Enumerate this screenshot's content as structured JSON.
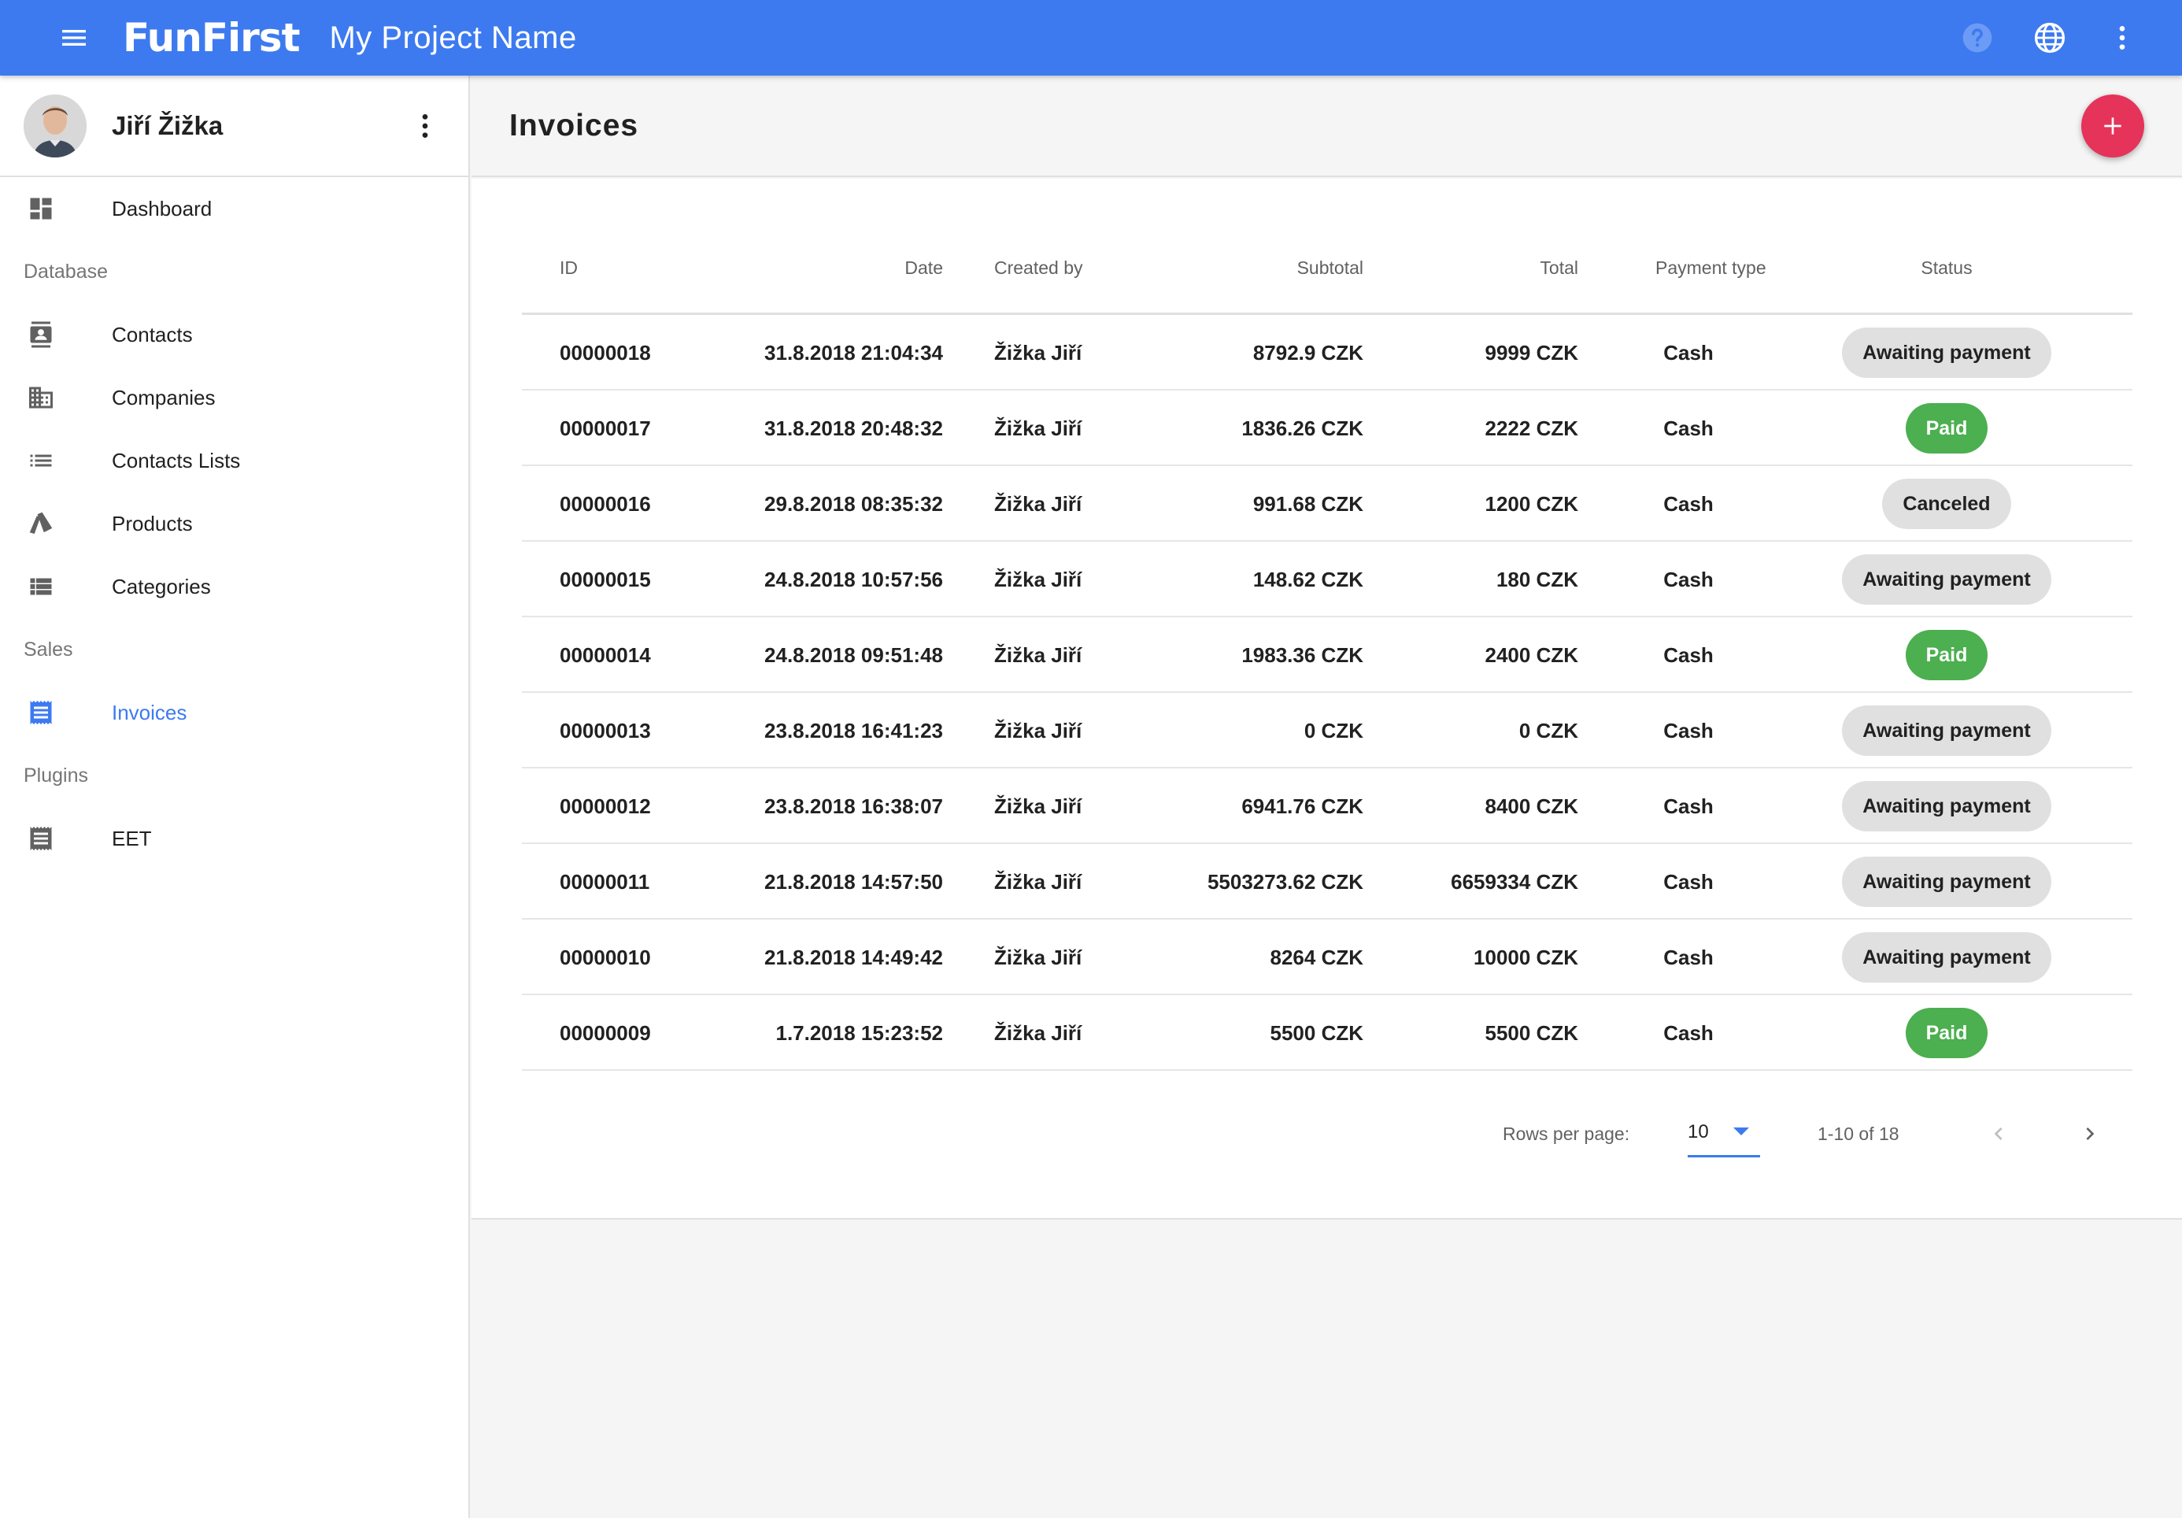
{
  "appbar": {
    "brand": "FunFirst",
    "project": "My Project Name",
    "icons": [
      "menu-icon",
      "help-icon",
      "globe-icon",
      "more-vert-icon"
    ],
    "color": "#3d7af0"
  },
  "sidebar": {
    "user_name": "Jiří Žižka",
    "dashboard": "Dashboard",
    "sections": {
      "database": "Database",
      "sales": "Sales",
      "plugins": "Plugins"
    },
    "items": {
      "contacts": "Contacts",
      "companies": "Companies",
      "contacts_lists": "Contacts Lists",
      "products": "Products",
      "categories": "Categories",
      "invoices": "Invoices",
      "eet": "EET"
    },
    "active": "invoices",
    "active_color": "#3d7af0"
  },
  "page": {
    "title": "Invoices",
    "fab_color": "#e5335a"
  },
  "table": {
    "headers": {
      "id": "ID",
      "date": "Date",
      "created_by": "Created by",
      "subtotal": "Subtotal",
      "total": "Total",
      "payment_type": "Payment type",
      "status": "Status"
    },
    "rows": [
      {
        "id": "00000018",
        "date": "31.8.2018 21:04:34",
        "created_by": "Žižka Jiří",
        "subtotal": "8792.9 CZK",
        "total": "9999 CZK",
        "payment_type": "Cash",
        "status": "Awaiting payment",
        "status_kind": "awaiting"
      },
      {
        "id": "00000017",
        "date": "31.8.2018 20:48:32",
        "created_by": "Žižka Jiří",
        "subtotal": "1836.26 CZK",
        "total": "2222 CZK",
        "payment_type": "Cash",
        "status": "Paid",
        "status_kind": "paid"
      },
      {
        "id": "00000016",
        "date": "29.8.2018 08:35:32",
        "created_by": "Žižka Jiří",
        "subtotal": "991.68 CZK",
        "total": "1200 CZK",
        "payment_type": "Cash",
        "status": "Canceled",
        "status_kind": "canceled"
      },
      {
        "id": "00000015",
        "date": "24.8.2018 10:57:56",
        "created_by": "Žižka Jiří",
        "subtotal": "148.62 CZK",
        "total": "180 CZK",
        "payment_type": "Cash",
        "status": "Awaiting payment",
        "status_kind": "awaiting"
      },
      {
        "id": "00000014",
        "date": "24.8.2018 09:51:48",
        "created_by": "Žižka Jiří",
        "subtotal": "1983.36 CZK",
        "total": "2400 CZK",
        "payment_type": "Cash",
        "status": "Paid",
        "status_kind": "paid"
      },
      {
        "id": "00000013",
        "date": "23.8.2018 16:41:23",
        "created_by": "Žižka Jiří",
        "subtotal": "0 CZK",
        "total": "0 CZK",
        "payment_type": "Cash",
        "status": "Awaiting payment",
        "status_kind": "awaiting"
      },
      {
        "id": "00000012",
        "date": "23.8.2018 16:38:07",
        "created_by": "Žižka Jiří",
        "subtotal": "6941.76 CZK",
        "total": "8400 CZK",
        "payment_type": "Cash",
        "status": "Awaiting payment",
        "status_kind": "awaiting"
      },
      {
        "id": "00000011",
        "date": "21.8.2018 14:57:50",
        "created_by": "Žižka Jiří",
        "subtotal": "5503273.62 CZK",
        "total": "6659334 CZK",
        "payment_type": "Cash",
        "status": "Awaiting payment",
        "status_kind": "awaiting"
      },
      {
        "id": "00000010",
        "date": "21.8.2018 14:49:42",
        "created_by": "Žižka Jiří",
        "subtotal": "8264 CZK",
        "total": "10000 CZK",
        "payment_type": "Cash",
        "status": "Awaiting payment",
        "status_kind": "awaiting"
      },
      {
        "id": "00000009",
        "date": "1.7.2018 15:23:52",
        "created_by": "Žižka Jiří",
        "subtotal": "5500 CZK",
        "total": "5500 CZK",
        "payment_type": "Cash",
        "status": "Paid",
        "status_kind": "paid"
      }
    ],
    "status_colors": {
      "paid": "#4caf50",
      "awaiting": "#e0e0e0",
      "canceled": "#e0e0e0"
    }
  },
  "pagination": {
    "rows_per_page_label": "Rows per page:",
    "rows_per_page": "10",
    "range": "1-10 of 18"
  }
}
